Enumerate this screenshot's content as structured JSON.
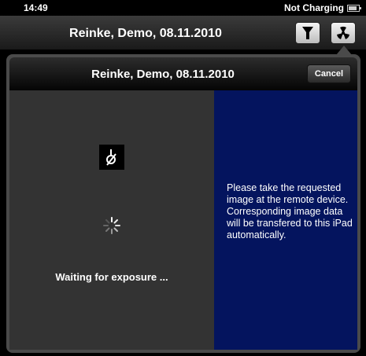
{
  "status_bar": {
    "time": "14:49",
    "charging": "Not Charging",
    "battery_fraction": 0.8
  },
  "nav": {
    "title": "Reinke, Demo, 08.11.2010",
    "filter_icon": "filter-icon",
    "radiation_icon": "radiation-icon"
  },
  "popover": {
    "title": "Reinke, Demo, 08.11.2010",
    "cancel_label": "Cancel",
    "waiting_text": "Waiting for exposure ...",
    "info_text": "Please take the requested image at the remote device. Corresponding image data will be transfered to this iPad automatically."
  },
  "colors": {
    "info_panel": "#04145e",
    "left_panel": "#333333"
  }
}
